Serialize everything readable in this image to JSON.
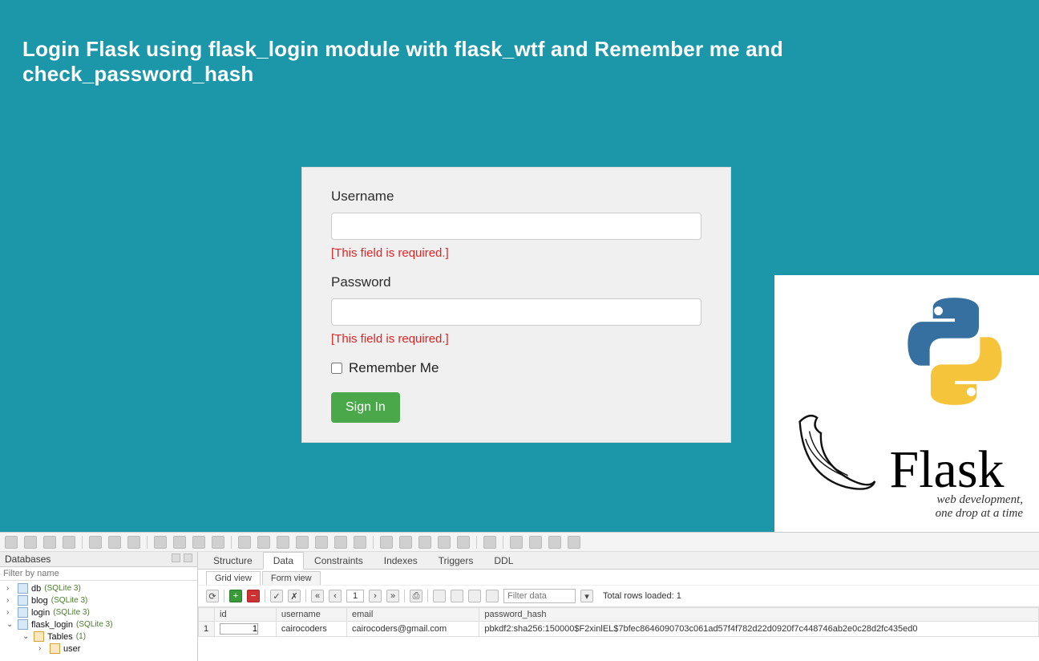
{
  "page_title": "Login Flask using flask_login module with flask_wtf and Remember me and check_password_hash",
  "login": {
    "username_label": "Username",
    "username_error": "[This field is required.]",
    "password_label": "Password",
    "password_error": "[This field is required.]",
    "remember_label": "Remember Me",
    "signin_label": "Sign In"
  },
  "flask": {
    "title": "Flask",
    "sub1": "web development,",
    "sub2": "one drop at a time"
  },
  "db": {
    "side_title": "Databases",
    "filter_placeholder": "Filter by name",
    "tree": [
      {
        "indent": 0,
        "arrow": "›",
        "icon": "db",
        "label": "db",
        "tag": "(SQLite 3)"
      },
      {
        "indent": 0,
        "arrow": "›",
        "icon": "db",
        "label": "blog",
        "tag": "(SQLite 3)"
      },
      {
        "indent": 0,
        "arrow": "›",
        "icon": "db",
        "label": "login",
        "tag": "(SQLite 3)"
      },
      {
        "indent": 0,
        "arrow": "⌄",
        "icon": "db",
        "label": "flask_login",
        "tag": "(SQLite 3)"
      },
      {
        "indent": 1,
        "arrow": "⌄",
        "icon": "tbl",
        "label": "Tables",
        "tag": "(1)"
      },
      {
        "indent": 2,
        "arrow": "›",
        "icon": "tbl",
        "label": "user",
        "tag": ""
      }
    ],
    "tabs": [
      "Structure",
      "Data",
      "Constraints",
      "Indexes",
      "Triggers",
      "DDL"
    ],
    "active_tab": 1,
    "subtabs": [
      "Grid view",
      "Form view"
    ],
    "active_subtab": 0,
    "page": "1",
    "filter_placeholder2": "Filter data",
    "total_label": "Total rows loaded: 1",
    "columns": [
      "id",
      "username",
      "email",
      "password_hash"
    ],
    "row": {
      "num": "1",
      "id": "1",
      "username": "cairocoders",
      "email": "cairocoders@gmail.com",
      "password_hash": "pbkdf2:sha256:150000$F2xinlEL$7bfec8646090703c061ad57f4f782d22d0920f7c448746ab2e0c28d2fc435ed0"
    }
  }
}
